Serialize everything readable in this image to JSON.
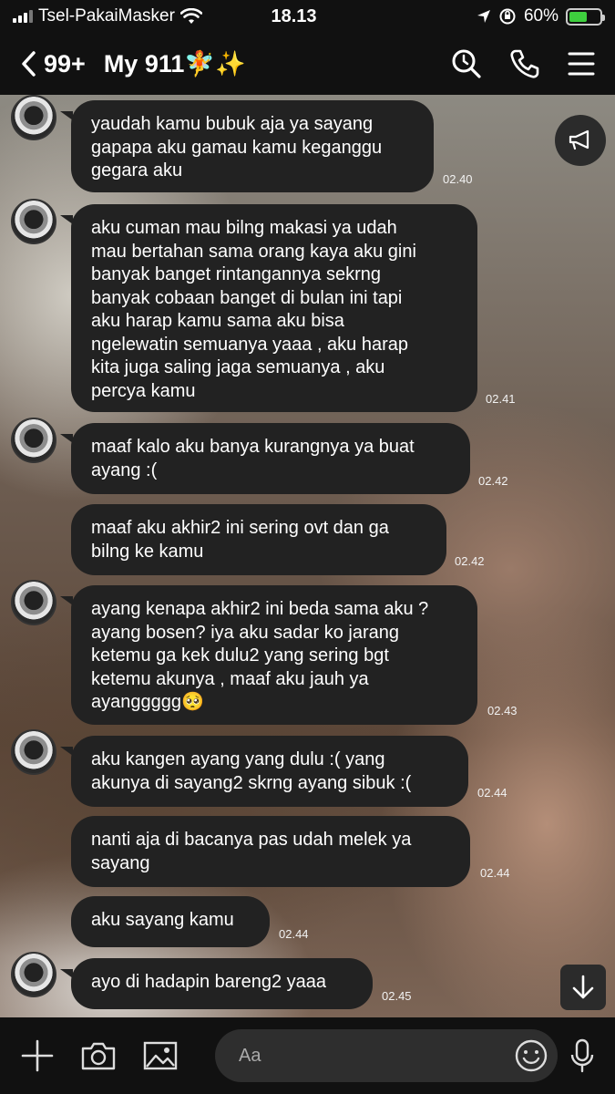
{
  "status_bar": {
    "carrier": "Tsel-PakaiMasker",
    "time": "18.13",
    "battery": "60%",
    "battery_level": 0.6
  },
  "header": {
    "back_count": "99+",
    "title": "My 911🧚✨",
    "icons": [
      "search-icon",
      "phone-icon",
      "menu-icon"
    ]
  },
  "messages": [
    {
      "text": "yaudah kamu bubuk aja ya sayang\ngapapa aku gamau kamu keganggu\ngegara aku",
      "time": "02.40"
    },
    {
      "text": "aku cuman mau bilng makasi ya udah\nmau bertahan sama orang kaya aku gini\nbanyak banget rintangannya sekrng\nbanyak cobaan banget di bulan ini  tapi\naku harap kamu sama aku bisa\nngelewatin semuanya yaaa , aku harap\nkita juga saling jaga semuanya , aku\npercya kamu",
      "time": "02.41"
    },
    {
      "text": "maaf kalo aku banya kurangnya ya buat\nayang :(",
      "time": "02.42"
    },
    {
      "text": "maaf aku akhir2 ini sering ovt dan ga\nbilng ke kamu",
      "time": "02.42"
    },
    {
      "text": "ayang kenapa akhir2 ini beda sama aku ?\nayang bosen? iya aku sadar ko jarang\nketemu ga kek dulu2 yang sering bgt\nketemu akunya  , maaf aku jauh ya\nayanggggg🥺",
      "time": "02.43"
    },
    {
      "text": "aku kangen ayang yang dulu :( yang\nakunya di sayang2  skrng ayang sibuk :(",
      "time": "02.44"
    },
    {
      "text": " nanti aja di bacanya pas udah melek ya\nsayang",
      "time": "02.44"
    },
    {
      "text": "aku sayang kamu",
      "time": "02.44"
    },
    {
      "text": "ayo di hadapin bareng2 yaaa",
      "time": "02.45"
    }
  ],
  "composer": {
    "placeholder": "Aa",
    "icons": [
      "plus-icon",
      "camera-icon",
      "image-icon",
      "emoji-icon",
      "microphone-icon"
    ]
  }
}
